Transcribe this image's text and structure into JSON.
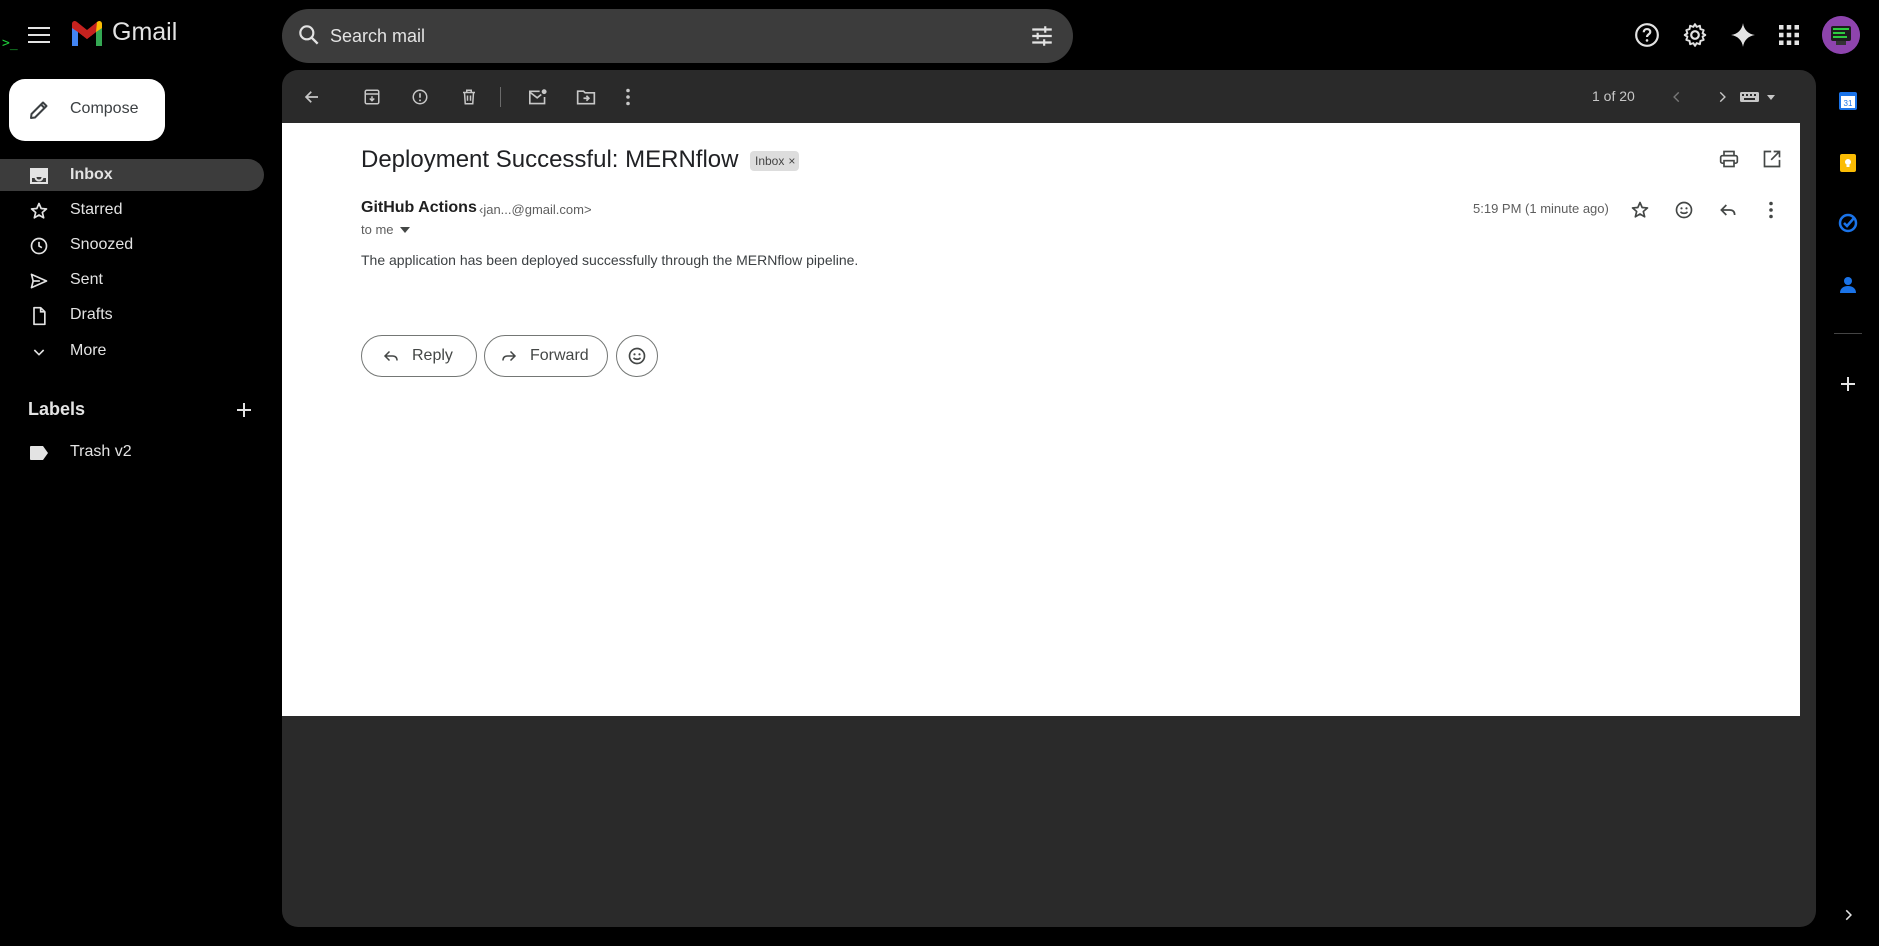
{
  "app": {
    "name": "Gmail"
  },
  "search": {
    "placeholder": "Search mail"
  },
  "sidebar": {
    "compose_label": "Compose",
    "items": [
      {
        "label": "Inbox",
        "icon": "inbox-icon",
        "active": true
      },
      {
        "label": "Starred",
        "icon": "star-icon"
      },
      {
        "label": "Snoozed",
        "icon": "clock-icon"
      },
      {
        "label": "Sent",
        "icon": "send-icon"
      },
      {
        "label": "Drafts",
        "icon": "draft-icon"
      },
      {
        "label": "More",
        "icon": "chevron-down-icon"
      }
    ],
    "labels_heading": "Labels",
    "labels": [
      {
        "label": "Trash v2",
        "icon": "label-icon"
      }
    ]
  },
  "toolbar": {
    "pager": "1 of 20"
  },
  "email": {
    "subject": "Deployment Successful: MERNflow",
    "chip": "Inbox",
    "chip_close": "×",
    "sender_name": "GitHub Actions",
    "sender_email": "‹jan...@gmail.com>",
    "recipient": "to me",
    "timestamp": "5:19 PM (1 minute ago)",
    "body": "The application has been deployed successfully through the MERNflow pipeline.",
    "reply_label": "Reply",
    "forward_label": "Forward"
  },
  "colors": {
    "background": "#000000",
    "panel": "#2a2a2a",
    "active_nav": "#3c3c3c",
    "terminal_green": "#1fd13b",
    "calendar_blue": "#1a73e8",
    "keep_yellow": "#fbbc04"
  },
  "rail": {
    "calendar_day": "31"
  },
  "terminal_mark": ">_"
}
